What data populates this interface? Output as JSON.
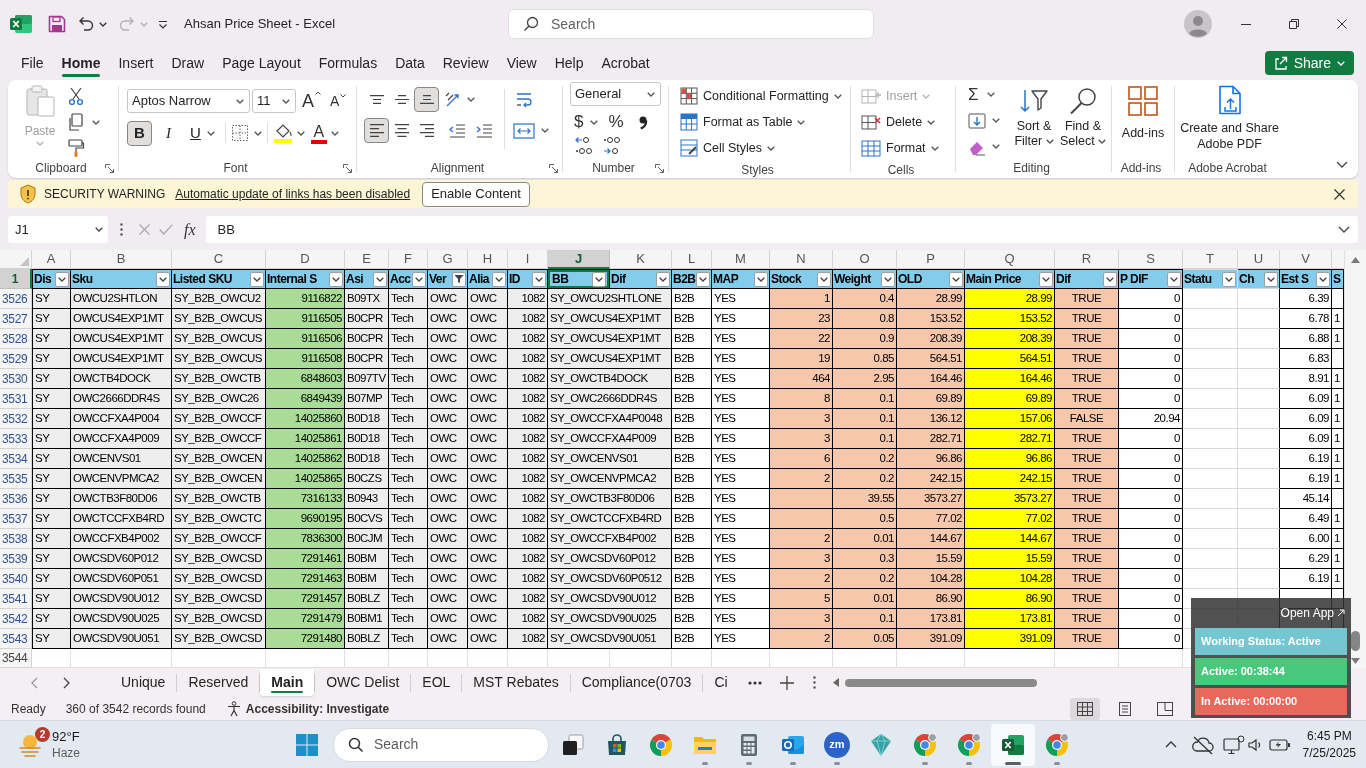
{
  "title_bar": {
    "title": "Ahsan Price Sheet - Excel",
    "undo": {
      "disabled": false
    },
    "redo": {
      "disabled": true
    },
    "search": {
      "placeholder": "Search"
    }
  },
  "menu_tabs": [
    {
      "label": "File",
      "selected": false
    },
    {
      "label": "Home",
      "selected": true
    },
    {
      "label": "Insert",
      "selected": false
    },
    {
      "label": "Draw",
      "selected": false
    },
    {
      "label": "Page Layout",
      "selected": false
    },
    {
      "label": "Formulas",
      "selected": false
    },
    {
      "label": "Data",
      "selected": false
    },
    {
      "label": "Review",
      "selected": false
    },
    {
      "label": "View",
      "selected": false
    },
    {
      "label": "Help",
      "selected": false
    },
    {
      "label": "Acrobat",
      "selected": false
    }
  ],
  "share_button": {
    "label": "Share"
  },
  "ribbon": {
    "clipboard": {
      "label": "Clipboard",
      "paste": {
        "label": "Paste",
        "disabled": true
      }
    },
    "font": {
      "label": "Font",
      "font_name": "Aptos Narrow",
      "font_size": "11",
      "grow": "A",
      "shrink": "A",
      "styles": [
        {
          "kind": "bold",
          "label": "B",
          "selected": true
        },
        {
          "kind": "italic",
          "label": "I",
          "selected": false
        },
        {
          "kind": "underline",
          "label": "U",
          "selected": false
        }
      ],
      "font_color": "A"
    },
    "alignment": {
      "label": "Alignment",
      "vertical": [
        {
          "kind": "top",
          "selected": false
        },
        {
          "kind": "middle",
          "selected": false
        },
        {
          "kind": "bottom",
          "selected": true
        }
      ],
      "horizontal": [
        {
          "kind": "left",
          "selected": true
        },
        {
          "kind": "center",
          "selected": false
        },
        {
          "kind": "right",
          "selected": false
        }
      ]
    },
    "number": {
      "label": "Number",
      "format": "General",
      "currency": "$",
      "percent": "%"
    },
    "styles": {
      "label": "Styles",
      "buttons": [
        {
          "kind": "conditional",
          "label": "Conditional Formatting"
        },
        {
          "kind": "table",
          "label": "Format as Table"
        },
        {
          "kind": "cell_styles",
          "label": "Cell Styles"
        }
      ]
    },
    "cells": {
      "label": "Cells",
      "buttons": [
        {
          "kind": "insert",
          "label": "Insert",
          "disabled": true
        },
        {
          "kind": "delete",
          "label": "Delete",
          "disabled": false
        },
        {
          "kind": "format",
          "label": "Format",
          "disabled": false
        }
      ]
    },
    "editing": {
      "label": "Editing",
      "autosum": "Σ",
      "sort_filter": "Sort & Filter",
      "find_select": "Find & Select"
    },
    "add_ins": {
      "label": "Add-ins",
      "button": "Add-ins"
    },
    "acrobat": {
      "label": "Adobe Acrobat",
      "button": "Create and Share Adobe PDF"
    }
  },
  "security_bar": {
    "title": "SECURITY WARNING",
    "message": "Automatic update of links has been disabled",
    "button": "Enable Content"
  },
  "formula_bar": {
    "name_box": "J1",
    "insert_function": "fx",
    "formula": "BB"
  },
  "sheet": {
    "columns": [
      {
        "letter": "A",
        "header": "Dis",
        "filtered": false,
        "selected": false,
        "color": "#eeeeee"
      },
      {
        "letter": "B",
        "header": "Sku",
        "filtered": false,
        "selected": false,
        "color": "#eeeeee"
      },
      {
        "letter": "C",
        "header": "Listed SKU",
        "filtered": false,
        "selected": false,
        "color": "#eeeeee"
      },
      {
        "letter": "D",
        "header": "Internal S",
        "filtered": false,
        "selected": false,
        "color": "#a9dc96"
      },
      {
        "letter": "E",
        "header": "Asi",
        "filtered": false,
        "selected": false,
        "color": "#eeeeee"
      },
      {
        "letter": "F",
        "header": "Acc",
        "filtered": false,
        "selected": false,
        "color": "#eeeeee"
      },
      {
        "letter": "G",
        "header": "Ver",
        "filtered": true,
        "selected": false,
        "color": "#eeeeee"
      },
      {
        "letter": "H",
        "header": "Alia",
        "filtered": false,
        "selected": false,
        "color": "#eeeeee"
      },
      {
        "letter": "I",
        "header": "ID",
        "filtered": false,
        "selected": false,
        "color": "#eeeeee"
      },
      {
        "letter": "J",
        "header": "BB",
        "filtered": false,
        "selected": true,
        "color": "#eeeeee"
      },
      {
        "letter": "K",
        "header": "Dif",
        "filtered": false,
        "selected": false
      },
      {
        "letter": "L",
        "header": "B2B",
        "filtered": false,
        "selected": false
      },
      {
        "letter": "M",
        "header": "MAP",
        "filtered": false,
        "selected": false
      },
      {
        "letter": "N",
        "header": "Stock",
        "filtered": false,
        "selected": false,
        "color": "#f7c7ac"
      },
      {
        "letter": "O",
        "header": "Weight",
        "filtered": false,
        "selected": false,
        "color": "#f7c7ac"
      },
      {
        "letter": "P",
        "header": "OLD",
        "filtered": false,
        "selected": false,
        "color": "#f7c7ac"
      },
      {
        "letter": "Q",
        "header": "Main Price",
        "filtered": false,
        "selected": false,
        "color": "#ffff00"
      },
      {
        "letter": "R",
        "header": "Dif",
        "filtered": false,
        "selected": false,
        "color": "#f7c7ac"
      },
      {
        "letter": "S",
        "header": "P DIF",
        "filtered": false,
        "selected": false
      },
      {
        "letter": "T",
        "header": "Statu",
        "filtered": false,
        "selected": false
      },
      {
        "letter": "U",
        "header": "Ch",
        "filtered": false,
        "selected": false
      },
      {
        "letter": "V",
        "header": "Est S",
        "filtered": false,
        "selected": false
      },
      {
        "header": "S"
      }
    ],
    "header_row": {
      "number": "1",
      "selected": true
    },
    "rows": [
      {
        "number": "3526",
        "cells": [
          "SY",
          "OWCU2SHTLON",
          "SY_B2B_OWCU2",
          "9116822",
          "B09TX",
          "Tech",
          "OWC",
          "OWC",
          "1082",
          "SY_OWCU2SHTLONE",
          null,
          "B2B",
          "YES",
          "1",
          "0.4",
          "28.99",
          "28.99",
          "TRUE",
          "0",
          null,
          null,
          "6.39",
          null
        ]
      },
      {
        "number": "3527",
        "cells": [
          "SY",
          "OWCUS4EXP1MT",
          "SY_B2B_OWCUS",
          "9116505",
          "B0CPR",
          "Tech",
          "OWC",
          "OWC",
          "1082",
          "SY_OWCUS4EXP1MT",
          null,
          "B2B",
          "YES",
          "23",
          "0.8",
          "153.52",
          "153.52",
          "TRUE",
          "0",
          null,
          null,
          "6.78",
          "1"
        ]
      },
      {
        "number": "3528",
        "cells": [
          "SY",
          "OWCUS4EXP1MT",
          "SY_B2B_OWCUS",
          "9116506",
          "B0CPR",
          "Tech",
          "OWC",
          "OWC",
          "1082",
          "SY_OWCUS4EXP1MT",
          null,
          "B2B",
          "YES",
          "22",
          "0.9",
          "208.39",
          "208.39",
          "TRUE",
          "0",
          null,
          null,
          "6.88",
          "1"
        ]
      },
      {
        "number": "3529",
        "cells": [
          "SY",
          "OWCUS4EXP1MT",
          "SY_B2B_OWCUS",
          "9116508",
          "B0CPR",
          "Tech",
          "OWC",
          "OWC",
          "1082",
          "SY_OWCUS4EXP1MT",
          null,
          "B2B",
          "YES",
          "19",
          "0.85",
          "564.51",
          "564.51",
          "TRUE",
          "0",
          null,
          null,
          "6.83",
          null
        ]
      },
      {
        "number": "3530",
        "cells": [
          "SY",
          "OWCTB4DOCK",
          "SY_B2B_OWCTB",
          "6848603",
          "B097TV",
          "Tech",
          "OWC",
          "OWC",
          "1082",
          "SY_OWCTB4DOCK",
          null,
          "B2B",
          "YES",
          "464",
          "2.95",
          "164.46",
          "164.46",
          "TRUE",
          "0",
          null,
          null,
          "8.91",
          "1"
        ]
      },
      {
        "number": "3531",
        "cells": [
          "SY",
          "OWC2666DDR4S",
          "SY_B2B_OWC26",
          "6849439",
          "B07MP",
          "Tech",
          "OWC",
          "OWC",
          "1082",
          "SY_OWC2666DDR4S",
          null,
          "B2B",
          "YES",
          "8",
          "0.1",
          "69.89",
          "69.89",
          "TRUE",
          "0",
          null,
          null,
          "6.09",
          "1"
        ]
      },
      {
        "number": "3532",
        "cells": [
          "SY",
          "OWCCFXA4P004",
          "SY_B2B_OWCCF",
          "14025860",
          "B0D18",
          "Tech",
          "OWC",
          "OWC",
          "1082",
          "SY_OWCCFXA4P0048",
          null,
          "B2B",
          "YES",
          "3",
          "0.1",
          "136.12",
          "157.06",
          "FALSE",
          "20.94",
          null,
          null,
          "6.09",
          "1"
        ]
      },
      {
        "number": "3533",
        "cells": [
          "SY",
          "OWCCFXA4P009",
          "SY_B2B_OWCCF",
          "14025861",
          "B0D18",
          "Tech",
          "OWC",
          "OWC",
          "1082",
          "SY_OWCCFXA4P009",
          null,
          "B2B",
          "YES",
          "3",
          "0.1",
          "282.71",
          "282.71",
          "TRUE",
          "0",
          null,
          null,
          "6.09",
          "1"
        ]
      },
      {
        "number": "3534",
        "cells": [
          "SY",
          "OWCENVS01",
          "SY_B2B_OWCEN",
          "14025862",
          "B0D18",
          "Tech",
          "OWC",
          "OWC",
          "1082",
          "SY_OWCENVS01",
          null,
          "B2B",
          "YES",
          "6",
          "0.2",
          "96.86",
          "96.86",
          "TRUE",
          "0",
          null,
          null,
          "6.19",
          "1"
        ]
      },
      {
        "number": "3535",
        "cells": [
          "SY",
          "OWCENVPMCA2",
          "SY_B2B_OWCEN",
          "14025865",
          "B0CZS",
          "Tech",
          "OWC",
          "OWC",
          "1082",
          "SY_OWCENVPMCA2",
          null,
          "B2B",
          "YES",
          "2",
          "0.2",
          "242.15",
          "242.15",
          "TRUE",
          "0",
          null,
          null,
          "6.19",
          "1"
        ]
      },
      {
        "number": "3536",
        "cells": [
          "SY",
          "OWCTB3F80D06",
          "SY_B2B_OWCTB",
          "7316133",
          "B0943",
          "Tech",
          "OWC",
          "OWC",
          "1082",
          "SY_OWCTB3F80D06",
          null,
          "B2B",
          "YES",
          null,
          "39.55",
          "3573.27",
          "3573.27",
          "TRUE",
          "0",
          null,
          null,
          "45.14",
          null
        ]
      },
      {
        "number": "3537",
        "cells": [
          "SY",
          "OWCTCCFXB4RD",
          "SY_B2B_OWCTC",
          "9690195",
          "B0CVS",
          "Tech",
          "OWC",
          "OWC",
          "1082",
          "SY_OWCTCCFXB4RD",
          null,
          "B2B",
          "YES",
          null,
          "0.5",
          "77.02",
          "77.02",
          "TRUE",
          "0",
          null,
          null,
          "6.49",
          "1"
        ]
      },
      {
        "number": "3538",
        "cells": [
          "SY",
          "OWCCFXB4P002",
          "SY_B2B_OWCCF",
          "7836300",
          "B0CJM",
          "Tech",
          "OWC",
          "OWC",
          "1082",
          "SY_OWCCFXB4P002",
          null,
          "B2B",
          "YES",
          "2",
          "0.01",
          "144.67",
          "144.67",
          "TRUE",
          "0",
          null,
          null,
          "6.00",
          "1"
        ]
      },
      {
        "number": "3539",
        "cells": [
          "SY",
          "OWCSDV60P012",
          "SY_B2B_OWCSD",
          "7291461",
          "B0BM",
          "Tech",
          "OWC",
          "OWC",
          "1082",
          "SY_OWCSDV60P012",
          null,
          "B2B",
          "YES",
          "3",
          "0.3",
          "15.59",
          "15.59",
          "TRUE",
          "0",
          null,
          null,
          "6.29",
          "1"
        ]
      },
      {
        "number": "3540",
        "cells": [
          "SY",
          "OWCSDV60P051",
          "SY_B2B_OWCSD",
          "7291463",
          "B0BM",
          "Tech",
          "OWC",
          "OWC",
          "1082",
          "SY_OWCSDV60P0512",
          null,
          "B2B",
          "YES",
          "2",
          "0.2",
          "104.28",
          "104.28",
          "TRUE",
          "0",
          null,
          null,
          "6.19",
          "1"
        ]
      },
      {
        "number": "3541",
        "cells": [
          "SY",
          "OWCSDV90U012",
          "SY_B2B_OWCSD",
          "7291457",
          "B0BLZ",
          "Tech",
          "OWC",
          "OWC",
          "1082",
          "SY_OWCSDV90U012",
          null,
          "B2B",
          "YES",
          "5",
          "0.01",
          "86.90",
          "86.90",
          "TRUE",
          "0",
          null,
          null,
          null,
          null
        ]
      },
      {
        "number": "3542",
        "cells": [
          "SY",
          "OWCSDV90U025",
          "SY_B2B_OWCSD",
          "7291479",
          "B0BM1",
          "Tech",
          "OWC",
          "OWC",
          "1082",
          "SY_OWCSDV90U025",
          null,
          "B2B",
          "YES",
          "3",
          "0.1",
          "173.81",
          "173.81",
          "TRUE",
          "0",
          null,
          null,
          null,
          null
        ]
      },
      {
        "number": "3543",
        "cells": [
          "SY",
          "OWCSDV90U051",
          "SY_B2B_OWCSD",
          "7291480",
          "B0BLZ",
          "Tech",
          "OWC",
          "OWC",
          "1082",
          "SY_OWCSDV90U051",
          null,
          "B2B",
          "YES",
          "2",
          "0.05",
          "391.09",
          "391.09",
          "TRUE",
          "0",
          null,
          null,
          null,
          null
        ]
      }
    ],
    "empty_row": {
      "number": "3544"
    }
  },
  "sheet_tabs": [
    {
      "label": "Unique",
      "selected": false
    },
    {
      "label": "Reserved",
      "selected": false
    },
    {
      "label": "Main",
      "selected": true
    },
    {
      "label": "OWC Delist",
      "selected": false
    },
    {
      "label": "EOL",
      "selected": false
    },
    {
      "label": "MST Rebates",
      "selected": false
    },
    {
      "label": "Compliance(0703",
      "selected": false
    },
    {
      "label": "Ci",
      "selected": false
    }
  ],
  "status_bar": {
    "mode": "Ready",
    "records": "360 of 3542 records found",
    "accessibility": "Accessibility: Investigate",
    "views": [
      {
        "kind": "normal",
        "selected": true
      },
      {
        "kind": "page_layout",
        "selected": false
      },
      {
        "kind": "page_break",
        "selected": false
      }
    ]
  },
  "status_widget": {
    "link": "Open App",
    "items": [
      {
        "label": "Working Status: Active",
        "color": "#74c6d0"
      },
      {
        "label": "Active: 00:38:44",
        "color": "#46c97b"
      },
      {
        "label": "In Active: 00:00:00",
        "color": "#e8685b"
      }
    ]
  },
  "taskbar": {
    "weather": {
      "badge": "2",
      "temperature": "92°F",
      "condition": "Haze"
    },
    "search": {
      "placeholder": "Search"
    },
    "apps": [
      {
        "kind": "task_view",
        "running": false,
        "active": false
      },
      {
        "kind": "store",
        "running": false,
        "active": false
      },
      {
        "kind": "browser",
        "running": false,
        "active": false
      },
      {
        "kind": "file_explorer",
        "running": true,
        "active": false
      },
      {
        "kind": "calculator",
        "running": true,
        "active": false
      },
      {
        "kind": "mail",
        "running": true,
        "active": false
      },
      {
        "kind": "video_meeting",
        "label": "zm",
        "running": true,
        "active": false
      },
      {
        "kind": "diamond",
        "running": false,
        "active": false
      },
      {
        "kind": "browser_profile",
        "running": true,
        "active": false
      },
      {
        "kind": "browser_profile",
        "running": true,
        "active": false
      },
      {
        "kind": "spreadsheet",
        "running": true,
        "active": true
      },
      {
        "kind": "browser_profile",
        "running": true,
        "active": false
      }
    ],
    "clock": {
      "time": "6:45 PM",
      "date": "7/25/2025"
    }
  }
}
